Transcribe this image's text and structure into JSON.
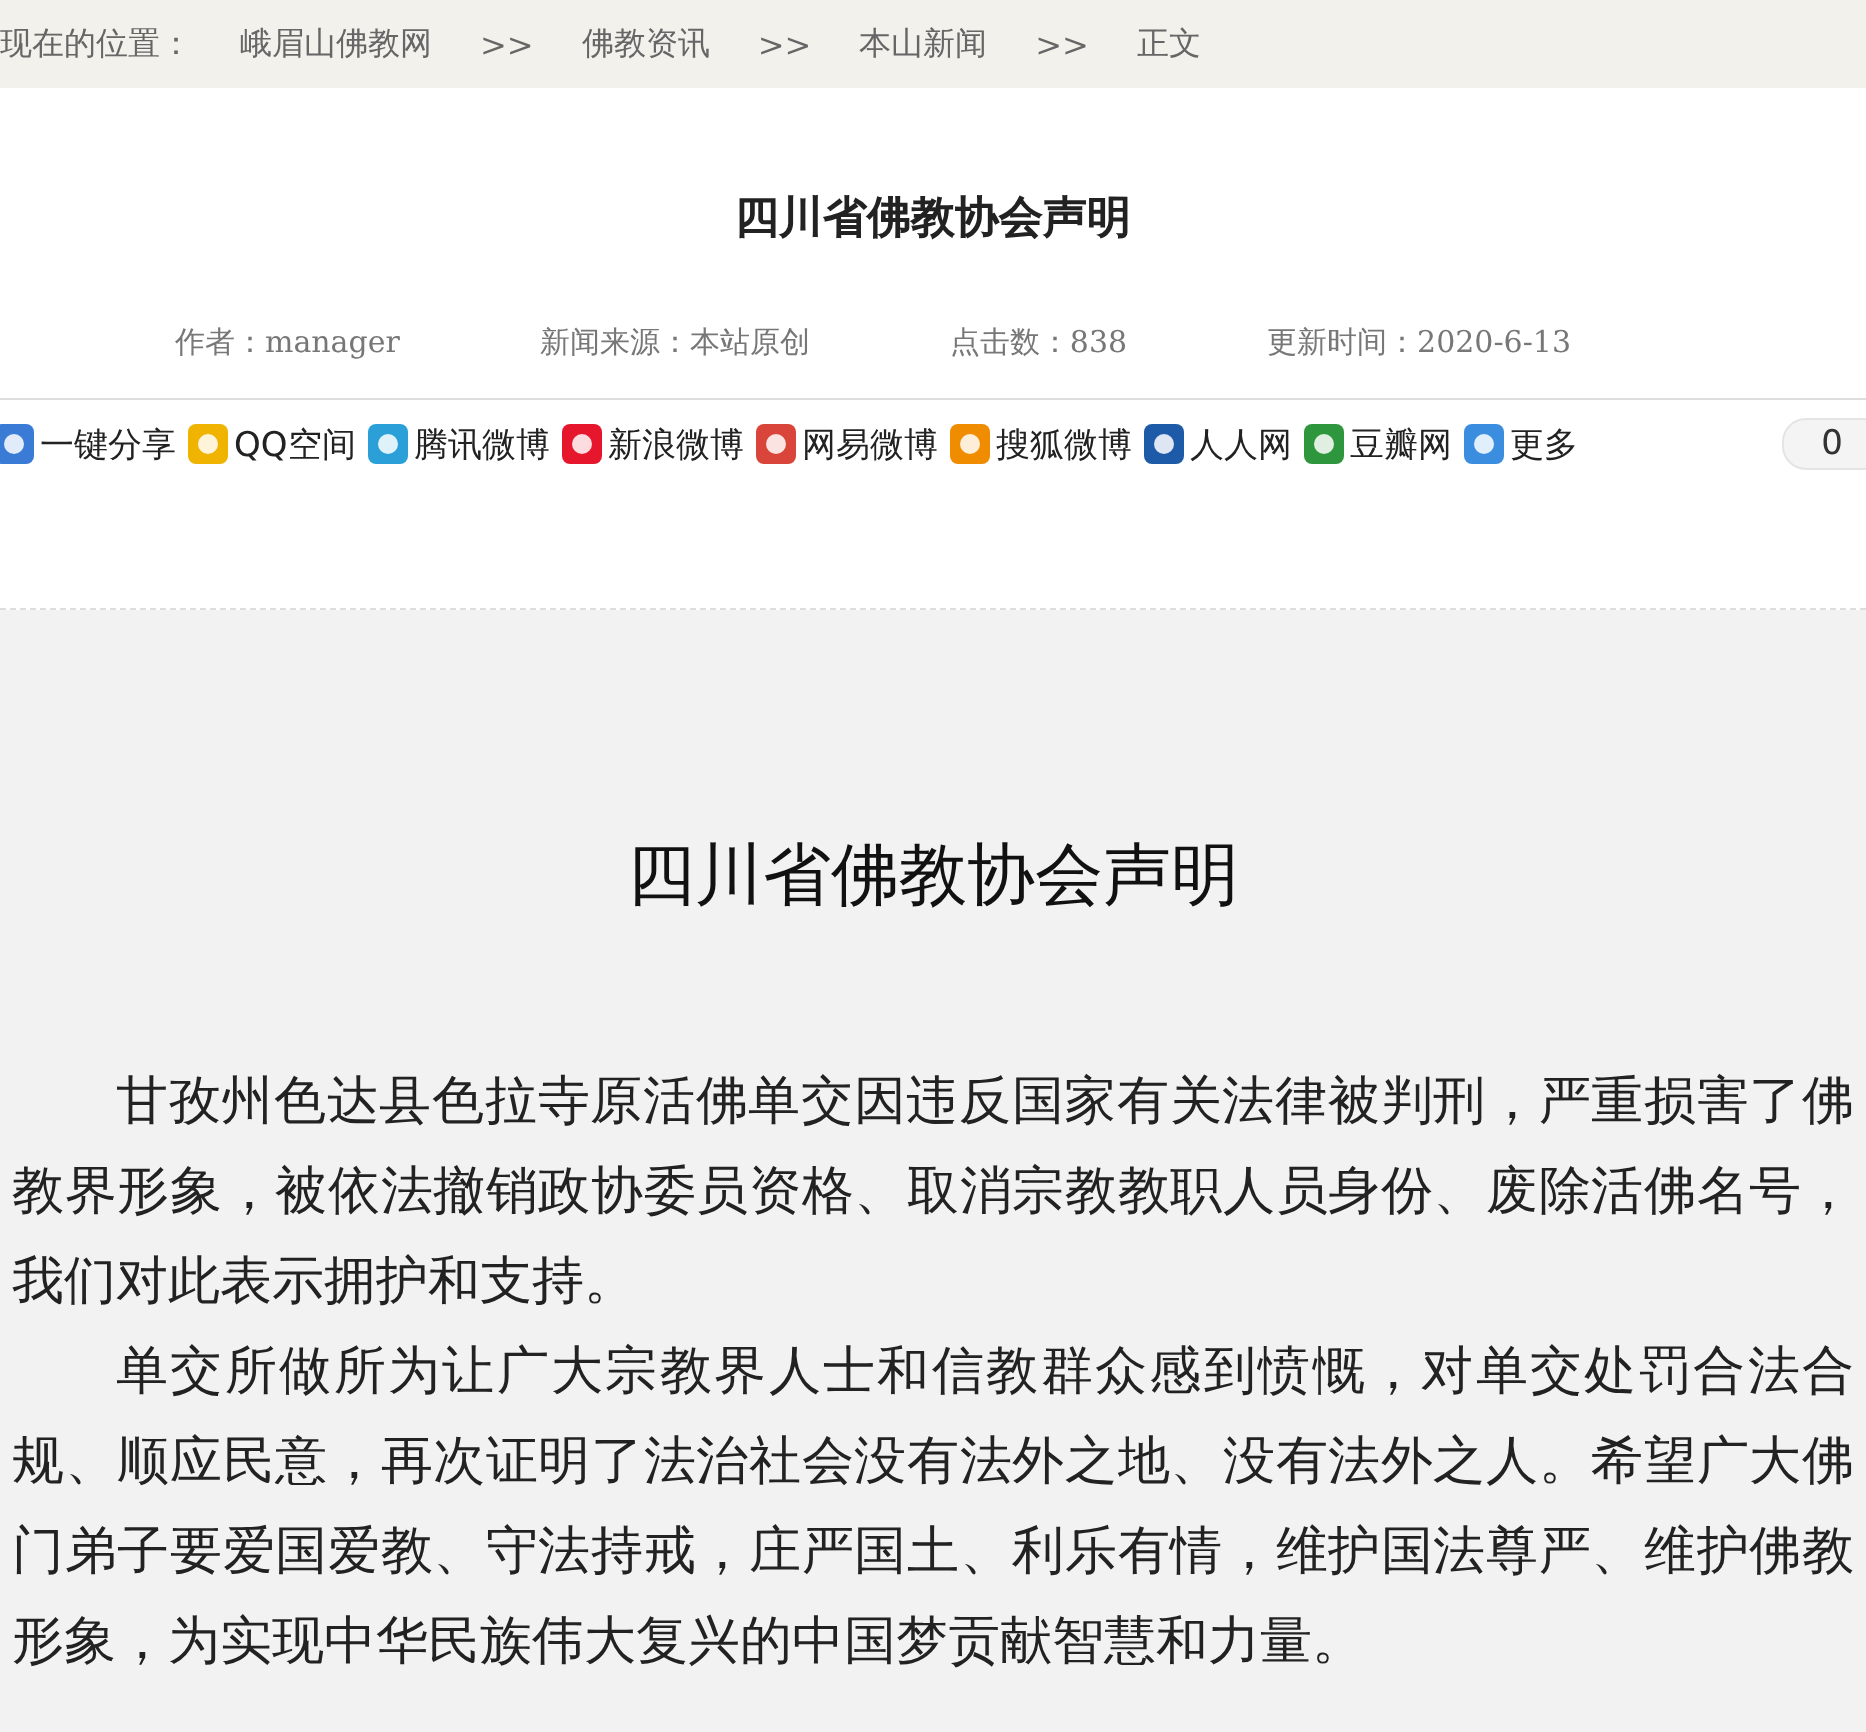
{
  "breadcrumb": {
    "label": "现在的位置：",
    "items": [
      "峨眉山佛教网",
      "佛教资讯",
      "本山新闻",
      "正文"
    ],
    "separator": ">>"
  },
  "header": {
    "title": "四川省佛教协会声明",
    "meta": [
      "作者：manager",
      "新闻来源：本站原创",
      "点击数：838",
      "更新时间：2020-6-13"
    ]
  },
  "share": {
    "items": [
      {
        "label": "一键分享",
        "color": "#3a7bd5"
      },
      {
        "label": "QQ空间",
        "color": "#f0b400"
      },
      {
        "label": "腾讯微博",
        "color": "#2a9fd8"
      },
      {
        "label": "新浪微博",
        "color": "#e6162d"
      },
      {
        "label": "网易微博",
        "color": "#d9453a"
      },
      {
        "label": "搜狐微博",
        "color": "#f08c00"
      },
      {
        "label": "人人网",
        "color": "#1d5ba8"
      },
      {
        "label": "豆瓣网",
        "color": "#2e963d"
      },
      {
        "label": "更多",
        "color": "#3b8de0"
      }
    ],
    "count": "0"
  },
  "article": {
    "title": "四川省佛教协会声明",
    "paragraphs": [
      "甘孜州色达县色拉寺原活佛单交因违反国家有关法律被判刑，严重损害了佛教界形象，被依法撤销政协委员资格、取消宗教教职人员身份、废除活佛名号，我们对此表示拥护和支持。",
      "单交所做所为让广大宗教界人士和信教群众感到愤慨，对单交处罚合法合规、顺应民意，再次证明了法治社会没有法外之地、没有法外之人。希望广大佛门弟子要爱国爱教、守法持戒，庄严国土、利乐有情，维护国法尊严、维护佛教形象，为实现中华民族伟大复兴的中国梦贡献智慧和力量。"
    ]
  }
}
